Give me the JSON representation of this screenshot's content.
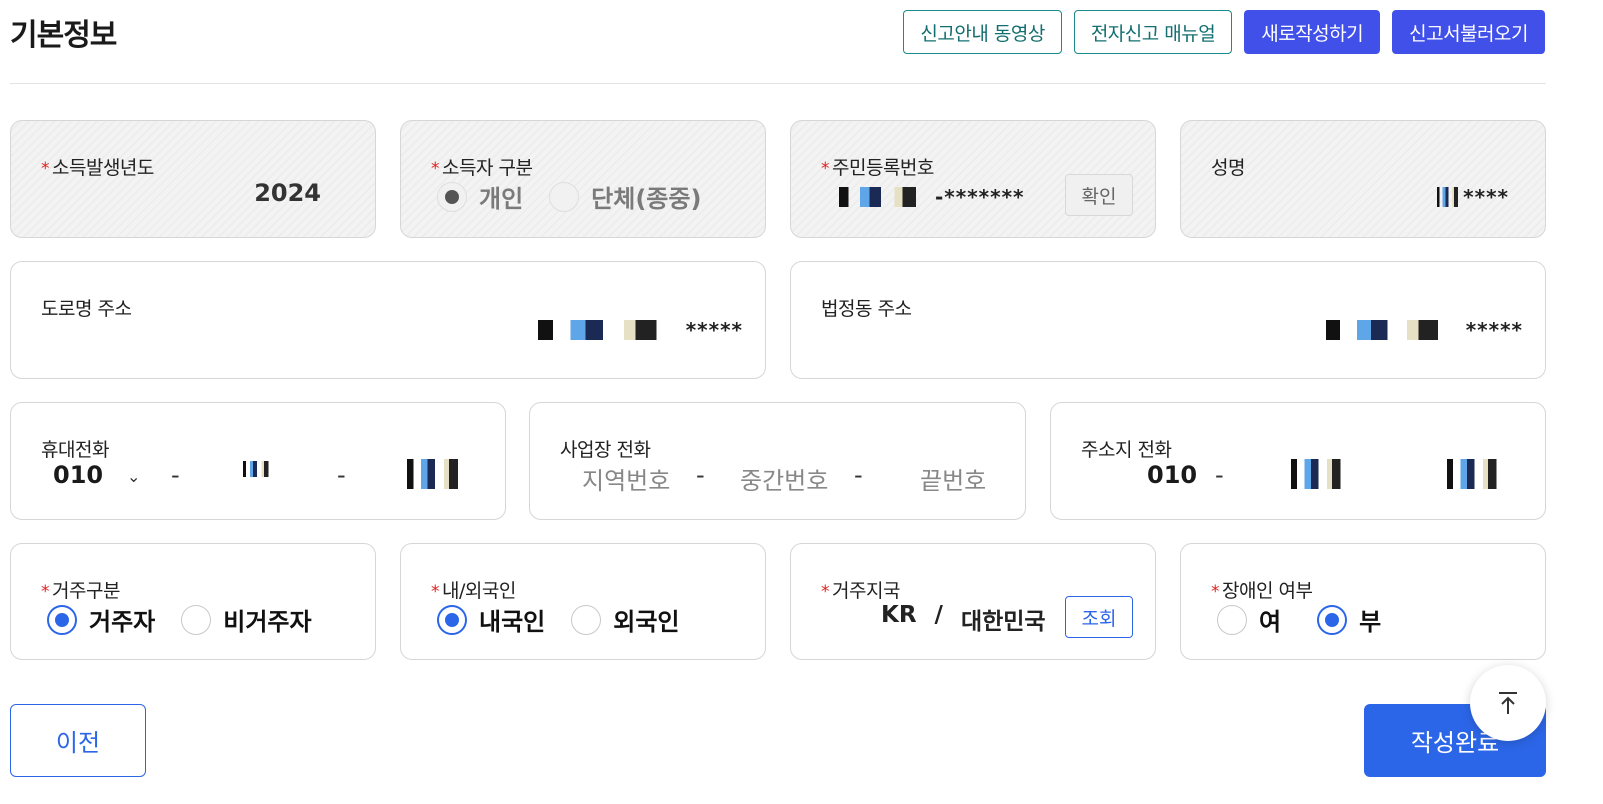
{
  "header": {
    "title": "기본정보",
    "actions": [
      "신고안내 동영상",
      "전자신고 매뉴얼",
      "새로작성하기",
      "신고서불러오기"
    ]
  },
  "income_year": {
    "label": "소득발생년도",
    "value": "2024"
  },
  "earner_type": {
    "label": "소득자 구분",
    "options": [
      "개인",
      "단체(종중)"
    ],
    "selected": "개인"
  },
  "rrn": {
    "label": "주민등록번호",
    "masked": "-*******",
    "button": "확인"
  },
  "name": {
    "label": "성명",
    "masked": "****"
  },
  "road_address": {
    "label": "도로명 주소",
    "masked": "*****"
  },
  "legal_address": {
    "label": "법정동 주소",
    "masked": "*****"
  },
  "mobile": {
    "label": "휴대전화",
    "prefix": "010",
    "dash": "-"
  },
  "work_phone": {
    "label": "사업장 전화",
    "placeholders": [
      "지역번호",
      "중간번호",
      "끝번호"
    ],
    "dash": "-"
  },
  "home_phone": {
    "label": "주소지 전화",
    "prefix": "010",
    "dash": "-"
  },
  "residence_type": {
    "label": "거주구분",
    "options": [
      "거주자",
      "비거주자"
    ],
    "selected": "거주자"
  },
  "nationality": {
    "label": "내/외국인",
    "options": [
      "내국인",
      "외국인"
    ],
    "selected": "내국인"
  },
  "residence_country": {
    "label": "거주지국",
    "code": "KR",
    "separator": "/",
    "name": "대한민국",
    "button": "조회"
  },
  "disability": {
    "label": "장애인 여부",
    "options": [
      "여",
      "부"
    ],
    "selected": "부"
  },
  "footer": {
    "prev": "이전",
    "done": "작성완료"
  },
  "required_mark": "*",
  "colors": {
    "primary": "#2c66e8",
    "action": "#4150e8",
    "outline": "#1b8a8a",
    "required": "#e02020"
  },
  "icons": {
    "scroll_top": "arrow-up-icon",
    "dropdown": "chevron-down-icon"
  }
}
